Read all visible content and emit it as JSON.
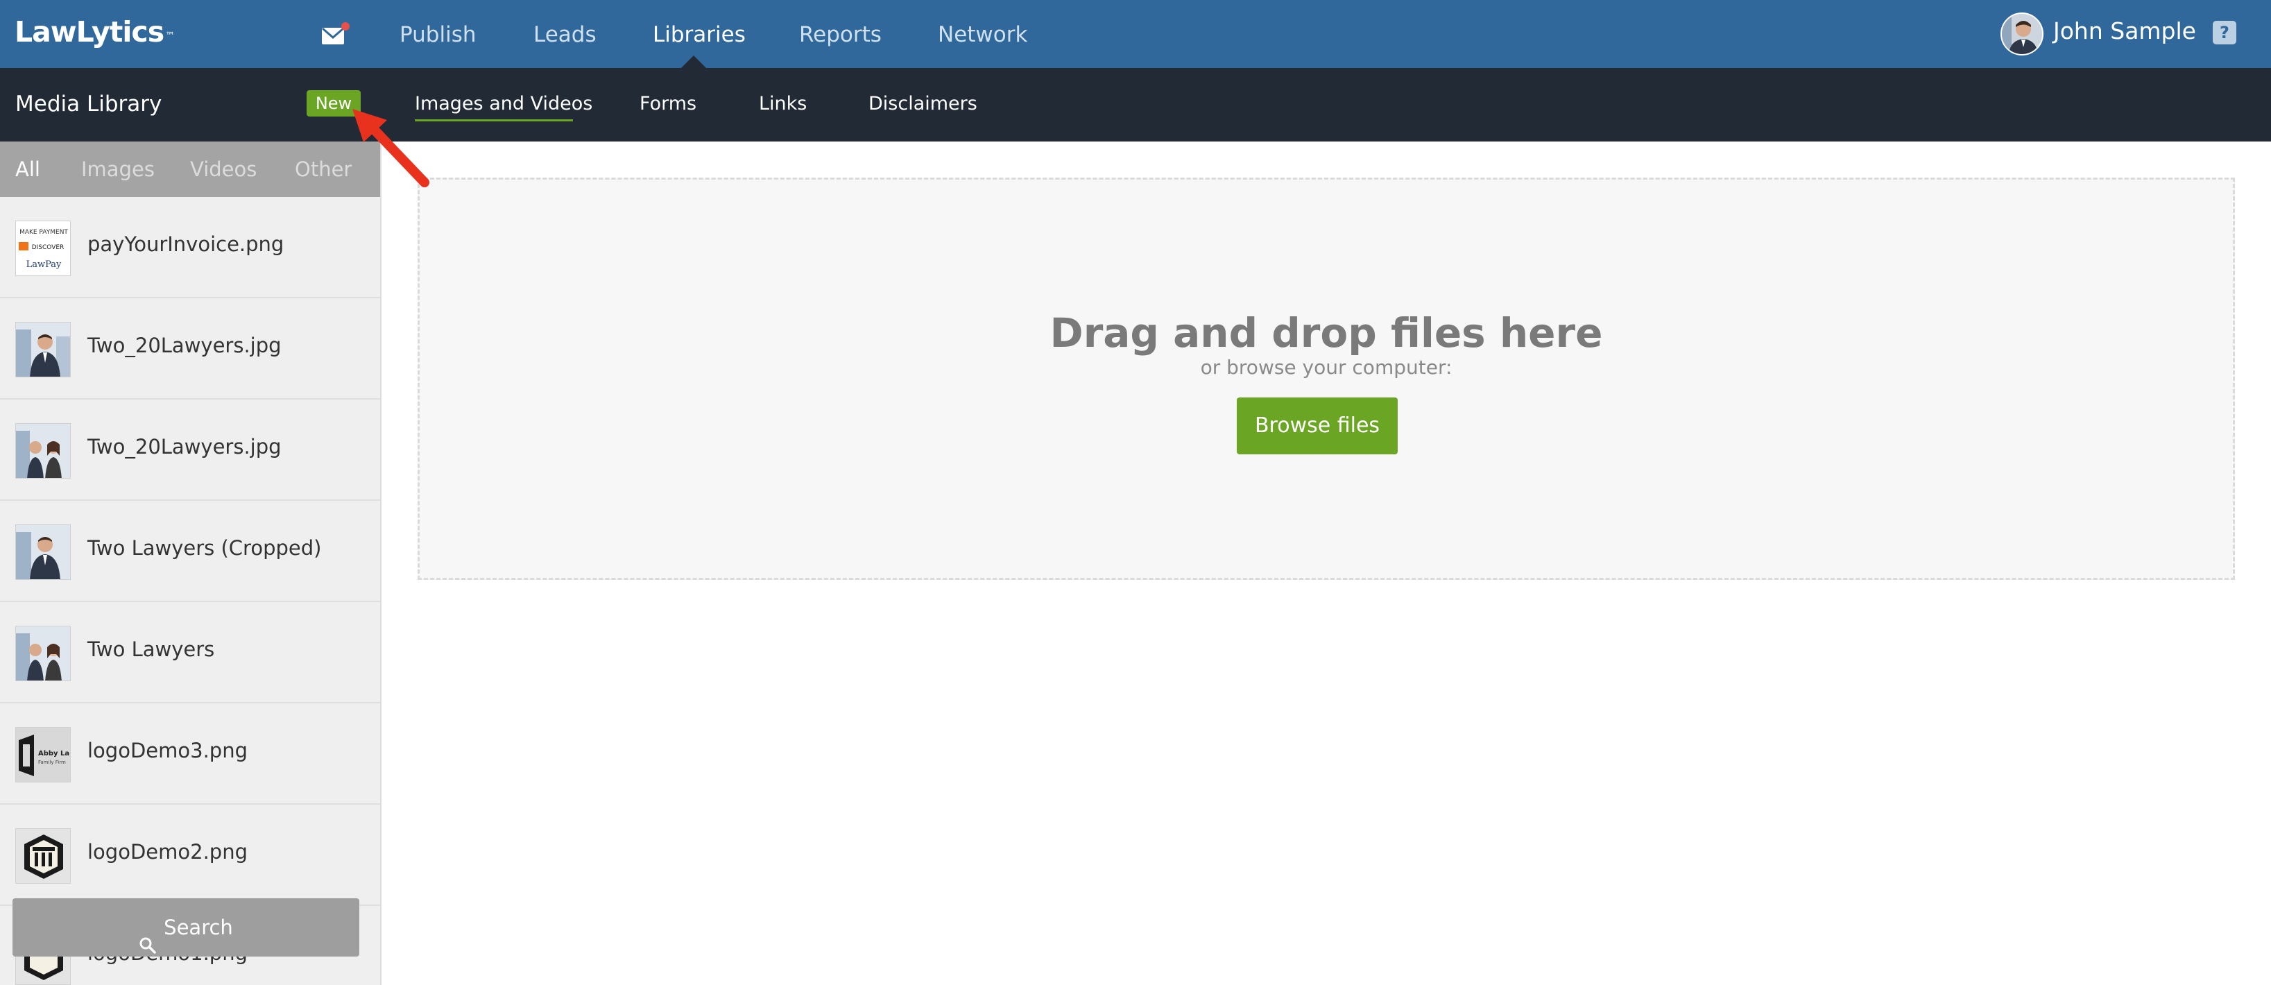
{
  "app": {
    "logo": "LawLytics",
    "trademark": "™"
  },
  "topnav": {
    "items": [
      {
        "label": "Publish"
      },
      {
        "label": "Leads"
      },
      {
        "label": "Libraries"
      },
      {
        "label": "Reports"
      },
      {
        "label": "Network"
      }
    ],
    "active": "Libraries"
  },
  "user": {
    "name": "John Sample",
    "help": "?"
  },
  "subbar": {
    "title": "Media Library",
    "new_label": "New",
    "items": [
      {
        "label": "Images and Videos"
      },
      {
        "label": "Forms"
      },
      {
        "label": "Links"
      },
      {
        "label": "Disclaimers"
      }
    ],
    "active": "Images and Videos"
  },
  "sidebar": {
    "filters": [
      {
        "label": "All"
      },
      {
        "label": "Images"
      },
      {
        "label": "Videos"
      },
      {
        "label": "Other"
      }
    ],
    "active_filter": "All",
    "media": [
      {
        "name": "payYourInvoice.png",
        "thumb": "invoice"
      },
      {
        "name": "Two_20Lawyers.jpg",
        "thumb": "lawyers"
      },
      {
        "name": "Two_20Lawyers.jpg",
        "thumb": "lawyers"
      },
      {
        "name": "Two Lawyers (Cropped)",
        "thumb": "lawyers"
      },
      {
        "name": "Two Lawyers",
        "thumb": "lawyers"
      },
      {
        "name": "logoDemo3.png",
        "thumb": "logo3"
      },
      {
        "name": "logoDemo2.png",
        "thumb": "logo2"
      },
      {
        "name": "logoDemo1.png",
        "thumb": "logo2"
      }
    ],
    "search_label": "Search"
  },
  "dropzone": {
    "title": "Drag and drop files here",
    "subtitle": "or browse your computer:",
    "button": "Browse files"
  },
  "colors": {
    "topbar": "#30689c",
    "subbar": "#212a35",
    "accent_green": "#6aa524",
    "annotation_arrow": "#e8321e"
  }
}
